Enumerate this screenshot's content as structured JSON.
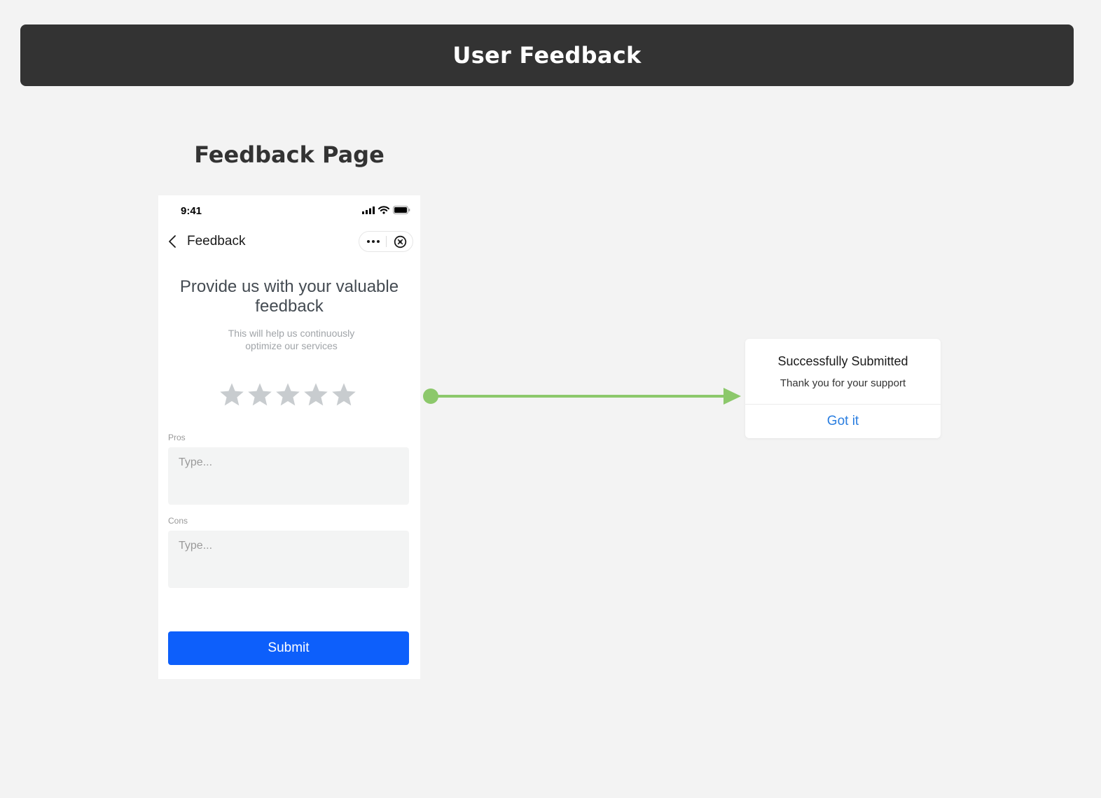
{
  "banner": {
    "title": "User Feedback"
  },
  "section": {
    "title": "Feedback Page"
  },
  "phone": {
    "status_bar": {
      "time": "9:41"
    },
    "navbar": {
      "title": "Feedback"
    },
    "headline": "Provide us with your valuable feedback",
    "subline": "This will help us continuously optimize our services",
    "rating": {
      "stars_total": 5,
      "stars_selected": 0,
      "star_color": "#c8cccf"
    },
    "pros": {
      "label": "Pros",
      "placeholder": "Type...",
      "value": ""
    },
    "cons": {
      "label": "Cons",
      "placeholder": "Type...",
      "value": ""
    },
    "submit_label": "Submit"
  },
  "dialog": {
    "title": "Successfully Submitted",
    "message": "Thank you for your support",
    "button_label": "Got it"
  },
  "colors": {
    "banner_bg": "#333333",
    "primary_button": "#0d5ffb",
    "link_blue": "#2a7ee0",
    "flow_arrow": "#8cc86b",
    "canvas_bg": "#f3f3f3"
  }
}
